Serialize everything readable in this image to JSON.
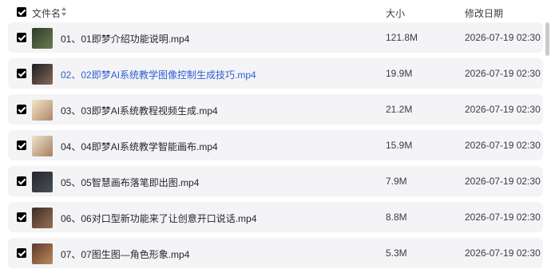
{
  "header": {
    "name_label": "文件名",
    "size_label": "大小",
    "date_label": "修改日期",
    "sort_icon": "sort-up-down-icon"
  },
  "files": [
    {
      "name": "01、01即梦介绍功能说明.mp4",
      "size": "121.8M",
      "modified": "2026-07-19 02:30",
      "checked": true,
      "thumb_colors": [
        "#2f3a2a",
        "#6a7d4e"
      ]
    },
    {
      "name": "02、02即梦AI系统教学图像控制生成技巧.mp4",
      "size": "19.9M",
      "modified": "2026-07-19 02:30",
      "checked": true,
      "thumb_colors": [
        "#1b1d22",
        "#8a6a5a"
      ]
    },
    {
      "name": "03、03即梦AI系统教程视频生成.mp4",
      "size": "21.2M",
      "modified": "2026-07-19 02:30",
      "checked": true,
      "thumb_colors": [
        "#f2e6c8",
        "#b0856a"
      ]
    },
    {
      "name": "04、04即梦AI系统教学智能画布.mp4",
      "size": "15.9M",
      "modified": "2026-07-19 02:30",
      "checked": true,
      "thumb_colors": [
        "#efe4cf",
        "#a6805e"
      ]
    },
    {
      "name": "05、05智慧画布落笔即出图.mp4",
      "size": "7.9M",
      "modified": "2026-07-19 02:30",
      "checked": true,
      "thumb_colors": [
        "#24262b",
        "#4a4f58"
      ]
    },
    {
      "name": "06、06对口型新功能来了让创意开口说话.mp4",
      "size": "8.8M",
      "modified": "2026-07-19 02:30",
      "checked": true,
      "thumb_colors": [
        "#3a2e2a",
        "#9a7050"
      ]
    },
    {
      "name": "07、07图生图—角色形象.mp4",
      "size": "5.3M",
      "modified": "2026-07-19 02:30",
      "checked": true,
      "thumb_colors": [
        "#5a3a2e",
        "#c08a5a"
      ]
    }
  ]
}
